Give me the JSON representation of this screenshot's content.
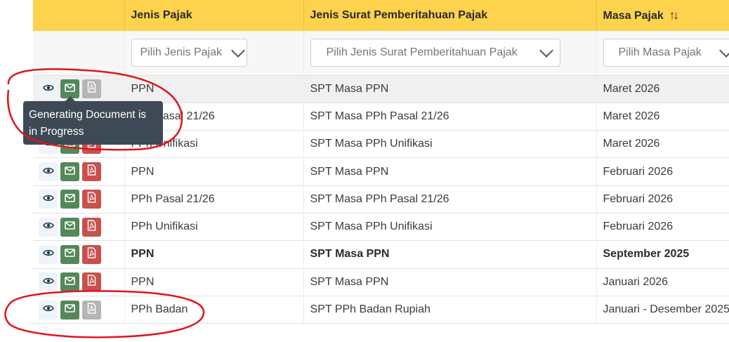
{
  "table": {
    "columns": [
      {
        "label": ""
      },
      {
        "label": "Jenis Pajak"
      },
      {
        "label": "Jenis Surat Pemberitahuan Pajak"
      },
      {
        "label": "Masa Pajak",
        "sort_icon": "↑↓"
      }
    ],
    "filters": {
      "jenis_pajak": "Pilih Jenis Pajak",
      "jenis_surat": "Pilih Jenis Surat Pemberitahuan Pajak",
      "masa_pajak": "Pilih Masa Pajak"
    },
    "rows": [
      {
        "jenis": "PPN",
        "surat": "SPT Masa PPN",
        "masa": "Maret 2026",
        "pdf": "disabled"
      },
      {
        "jenis": "PPh Pasal 21/26",
        "surat": "SPT Masa PPh Pasal 21/26",
        "masa": "Maret 2026",
        "pdf": "enabled"
      },
      {
        "jenis": "PPh Unifikasi",
        "surat": "SPT Masa PPh Unifikasi",
        "masa": "Maret 2026",
        "pdf": "enabled"
      },
      {
        "jenis": "PPN",
        "surat": "SPT Masa PPN",
        "masa": "Februari 2026",
        "pdf": "enabled"
      },
      {
        "jenis": "PPh Pasal 21/26",
        "surat": "SPT Masa PPh Pasal 21/26",
        "masa": "Februari 2026",
        "pdf": "enabled"
      },
      {
        "jenis": "PPh Unifikasi",
        "surat": "SPT Masa PPh Unifikasi",
        "masa": "Februari 2026",
        "pdf": "enabled"
      },
      {
        "jenis": "PPN",
        "surat": "SPT Masa PPN",
        "masa": "September 2025",
        "pdf": "enabled"
      },
      {
        "jenis": "PPN",
        "surat": "SPT Masa PPN",
        "masa": "Januari 2026",
        "pdf": "enabled"
      },
      {
        "jenis": "PPh Badan",
        "surat": "SPT PPh Badan Rupiah",
        "masa": "Januari - Desember 2025",
        "pdf": "disabled"
      }
    ]
  },
  "tooltip": {
    "text": "Generating Document is in Progress"
  },
  "icons": {
    "view": "eye-icon",
    "mail": "mail-icon",
    "pdf": "pdf-icon",
    "dropdown": "chevron-down-icon"
  },
  "colors": {
    "header_bg": "#fdd24c",
    "mail_btn": "#54875a",
    "pdf_btn": "#c9504c",
    "pdf_btn_disabled": "#b5b5b5",
    "tooltip_bg": "#3d4a55",
    "annotation": "#e0141e"
  }
}
